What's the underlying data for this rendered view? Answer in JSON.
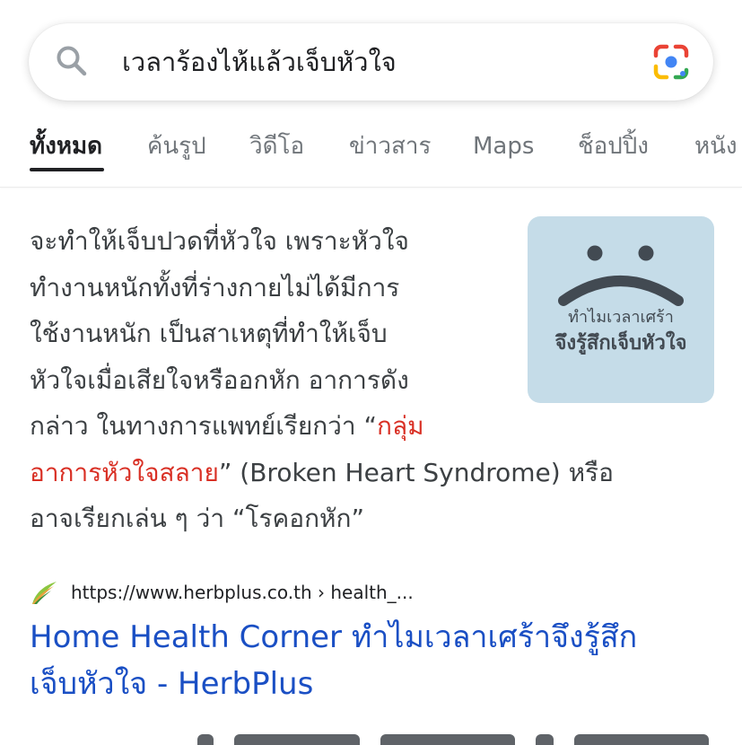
{
  "search": {
    "query": "เวลาร้องไห้แล้วเจ็บหัวใจ",
    "search_icon": "search-icon",
    "lens_icon": "google-lens-icon"
  },
  "tabs": [
    {
      "label": "ทั้งหมด",
      "active": true
    },
    {
      "label": "ค้นรูป",
      "active": false
    },
    {
      "label": "วิดีโอ",
      "active": false
    },
    {
      "label": "ข่าวสาร",
      "active": false
    },
    {
      "label": "Maps",
      "active": false
    },
    {
      "label": "ช็อปปิ้ง",
      "active": false
    },
    {
      "label": "หนัง",
      "active": false
    }
  ],
  "snippet": {
    "lines": [
      "จะทำให้เจ็บปวดที่หัวใจ เพราะหัวใจ",
      "ทำงานหนักทั้งที่ร่างกายไม่ได้มีการ",
      "ใช้งานหนัก เป็นสาเหตุที่ทำให้เจ็บ",
      "หัวใจเมื่อเสียใจหรืออกหัก อาการดัง",
      "กล่าว ในทางการแพทย์เรียกว่า “",
      "กลุ่ม",
      "อาการหัวใจสลาย",
      "” (Broken Heart Syndrome) หรือ",
      "อาจเรียกเล่น ๆ ว่า “โรคอกหัก”"
    ],
    "thumbnail": {
      "icon": "sad-face-icon",
      "line1": "ทำไมเวลาเศร้า",
      "line2": "จึงรู้สึกเจ็บหัวใจ",
      "bg_color": "#c5dce8"
    },
    "highlight_color": "#d93025"
  },
  "result": {
    "favicon": "herbplus-leaf-icon",
    "url": "https://www.herbplus.co.th › health_...",
    "title_line1": "Home Health Corner ทำไมเวลาเศร้าจึงรู้สึก",
    "title_line2": "เจ็บหัวใจ - HerbPlus",
    "title_color": "#1a4fc4"
  }
}
